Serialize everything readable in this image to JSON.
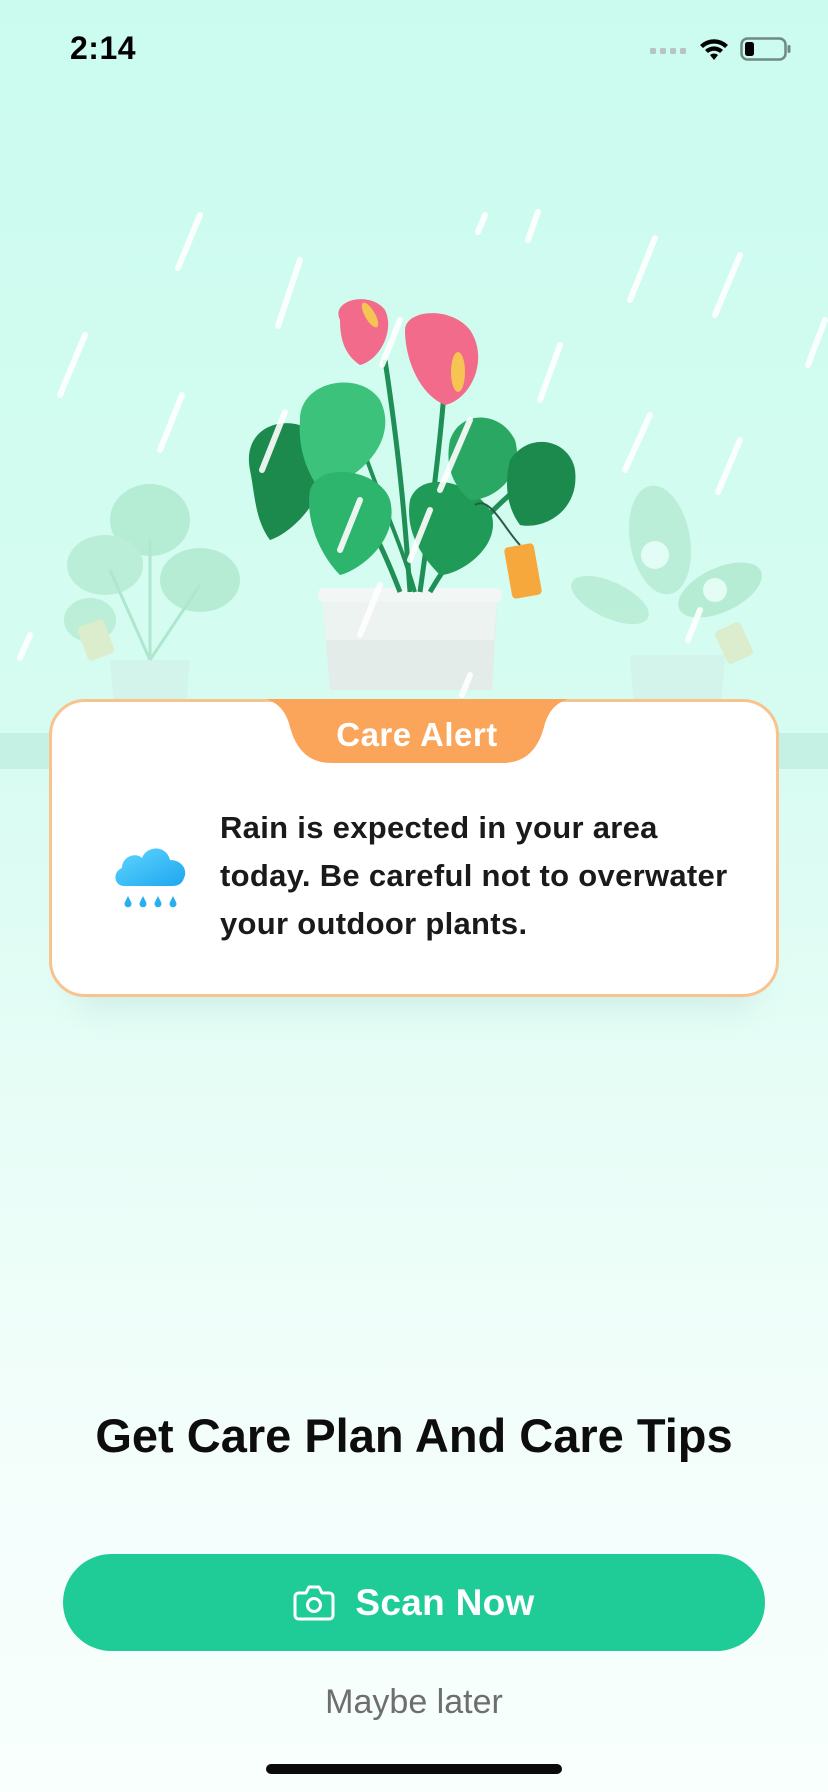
{
  "status_bar": {
    "time": "2:14"
  },
  "alert": {
    "tab_label": "Care Alert",
    "message": "Rain is expected in your area today. Be careful not to overwater your outdoor plants.",
    "icon": "rain-cloud-icon"
  },
  "headline": "Get Care Plan And Care Tips",
  "scan_button": {
    "label": "Scan Now",
    "icon": "camera-icon"
  },
  "maybe_later": "Maybe later",
  "colors": {
    "accent": "#1fcc98",
    "alert_orange": "#fba55a",
    "background_top": "#cbfbef"
  }
}
